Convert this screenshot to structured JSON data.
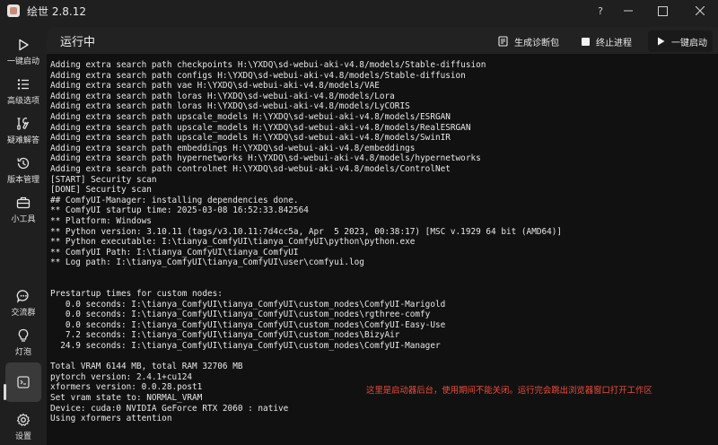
{
  "window": {
    "title": "绘世 2.8.12"
  },
  "sidebar": {
    "items": [
      {
        "label": "一键启动",
        "icon": "play-icon"
      },
      {
        "label": "高级选项",
        "icon": "list-icon"
      },
      {
        "label": "疑难解答",
        "icon": "tools-icon"
      },
      {
        "label": "版本管理",
        "icon": "history-icon"
      },
      {
        "label": "小工具",
        "icon": "toolbox-icon"
      },
      {
        "label": "交流群",
        "icon": "chat-icon"
      },
      {
        "label": "灯泡",
        "icon": "lightbulb-icon"
      },
      {
        "label": "",
        "icon": "console-icon"
      },
      {
        "label": "设置",
        "icon": "settings-icon"
      }
    ]
  },
  "header": {
    "title": "运行中",
    "diag_label": "生成诊断包",
    "stop_label": "终止进程",
    "launch_label": "一键启动"
  },
  "console": {
    "lines": [
      "Adding extra search path checkpoints H:\\YXDQ\\sd-webui-aki-v4.8/models/Stable-diffusion",
      "Adding extra search path configs H:\\YXDQ\\sd-webui-aki-v4.8/models/Stable-diffusion",
      "Adding extra search path vae H:\\YXDQ\\sd-webui-aki-v4.8/models/VAE",
      "Adding extra search path loras H:\\YXDQ\\sd-webui-aki-v4.8/models/Lora",
      "Adding extra search path loras H:\\YXDQ\\sd-webui-aki-v4.8/models/LyCORIS",
      "Adding extra search path upscale_models H:\\YXDQ\\sd-webui-aki-v4.8/models/ESRGAN",
      "Adding extra search path upscale_models H:\\YXDQ\\sd-webui-aki-v4.8/models/RealESRGAN",
      "Adding extra search path upscale_models H:\\YXDQ\\sd-webui-aki-v4.8/models/SwinIR",
      "Adding extra search path embeddings H:\\YXDQ\\sd-webui-aki-v4.8/embeddings",
      "Adding extra search path hypernetworks H:\\YXDQ\\sd-webui-aki-v4.8/models/hypernetworks",
      "Adding extra search path controlnet H:\\YXDQ\\sd-webui-aki-v4.8/models/ControlNet",
      "[START] Security scan",
      "[DONE] Security scan",
      "## ComfyUI-Manager: installing dependencies done.",
      "** ComfyUI startup time: 2025-03-08 16:52:33.842564",
      "** Platform: Windows",
      "** Python version: 3.10.11 (tags/v3.10.11:7d4cc5a, Apr  5 2023, 00:38:17) [MSC v.1929 64 bit (AMD64)]",
      "** Python executable: I:\\tianya_ComfyUI\\tianya_ComfyUI\\python\\python.exe",
      "** ComfyUI Path: I:\\tianya_ComfyUI\\tianya_ComfyUI",
      "** Log path: I:\\tianya_ComfyUI\\tianya_ComfyUI\\user\\comfyui.log",
      "",
      "",
      "Prestartup times for custom nodes:",
      "   0.0 seconds: I:\\tianya_ComfyUI\\tianya_ComfyUI\\custom_nodes\\ComfyUI-Marigold",
      "   0.0 seconds: I:\\tianya_ComfyUI\\tianya_ComfyUI\\custom_nodes\\rgthree-comfy",
      "   0.0 seconds: I:\\tianya_ComfyUI\\tianya_ComfyUI\\custom_nodes\\ComfyUI-Easy-Use",
      "   7.2 seconds: I:\\tianya_ComfyUI\\tianya_ComfyUI\\custom_nodes\\BizyAir",
      "  24.9 seconds: I:\\tianya_ComfyUI\\tianya_ComfyUI\\custom_nodes\\ComfyUI-Manager",
      "",
      "Total VRAM 6144 MB, total RAM 32706 MB",
      "pytorch version: 2.4.1+cu124",
      "xformers version: 0.0.28.post1",
      "Set vram state to: NORMAL_VRAM",
      "Device: cuda:0 NVIDIA GeForce RTX 2060 : native",
      "Using xformers attention"
    ],
    "notice": "这里是启动器后台，使用期间不能关闭。运行完会跳出浏览器窗口打开工作区"
  }
}
